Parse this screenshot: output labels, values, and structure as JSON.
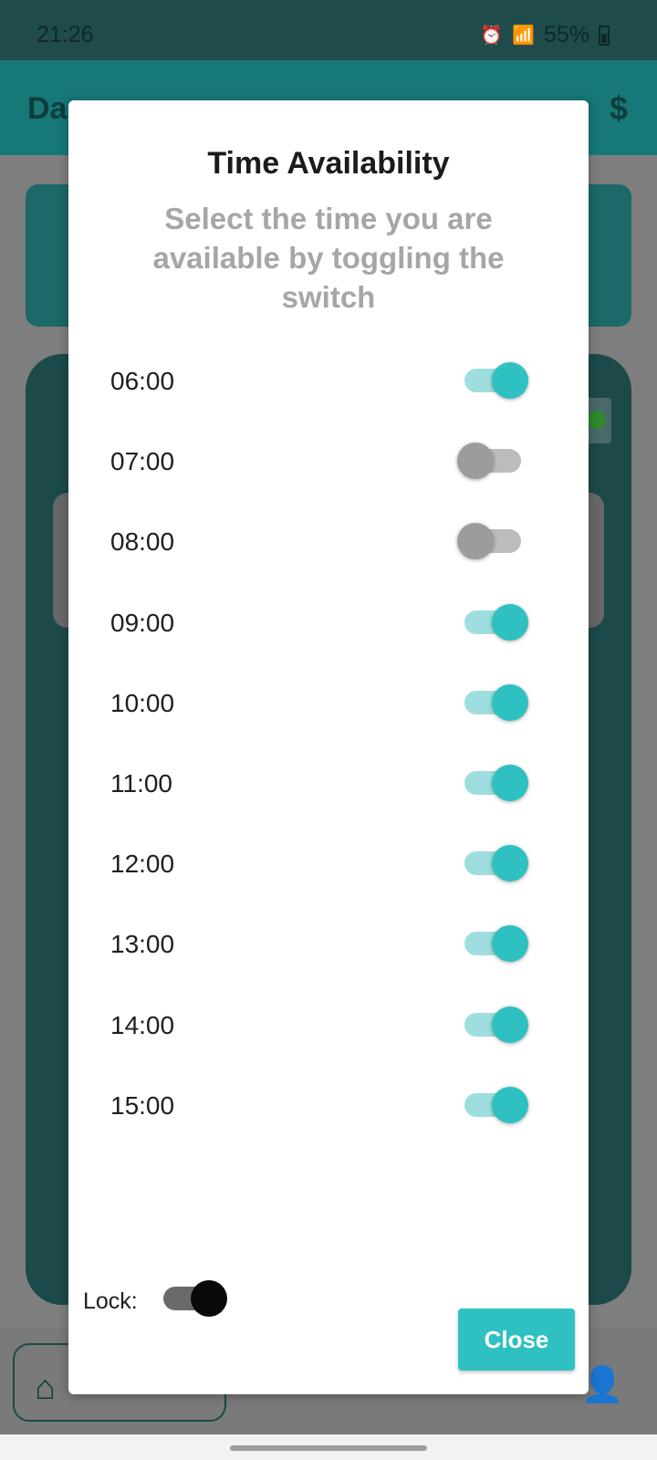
{
  "status_bar": {
    "time": "21:26",
    "battery": "55%",
    "icons": [
      "alarm-icon",
      "wifi-icon",
      "signal-icon",
      "battery-icon"
    ]
  },
  "app_header": {
    "title": "Da",
    "icons": [
      "cart-off-icon",
      "currency-icon",
      "dollar-icon"
    ],
    "dollar": "$"
  },
  "modal": {
    "title": "Time Availability",
    "subtitle": "Select the time you are available by toggling the switch",
    "slots": [
      {
        "time": "06:00",
        "on": true
      },
      {
        "time": "07:00",
        "on": false
      },
      {
        "time": "08:00",
        "on": false
      },
      {
        "time": "09:00",
        "on": true
      },
      {
        "time": "10:00",
        "on": true
      },
      {
        "time": "11:00",
        "on": true
      },
      {
        "time": "12:00",
        "on": true
      },
      {
        "time": "13:00",
        "on": true
      },
      {
        "time": "14:00",
        "on": true
      },
      {
        "time": "15:00",
        "on": true
      }
    ],
    "lock_label": "Lock:",
    "lock_on": true,
    "close_label": "Close"
  },
  "colors": {
    "accent": "#2fc1c1",
    "accent_track": "#9edede",
    "off_knob": "#9c9c9c"
  },
  "bottom_nav": {
    "icons": [
      "home-icon",
      "person-icon"
    ]
  }
}
